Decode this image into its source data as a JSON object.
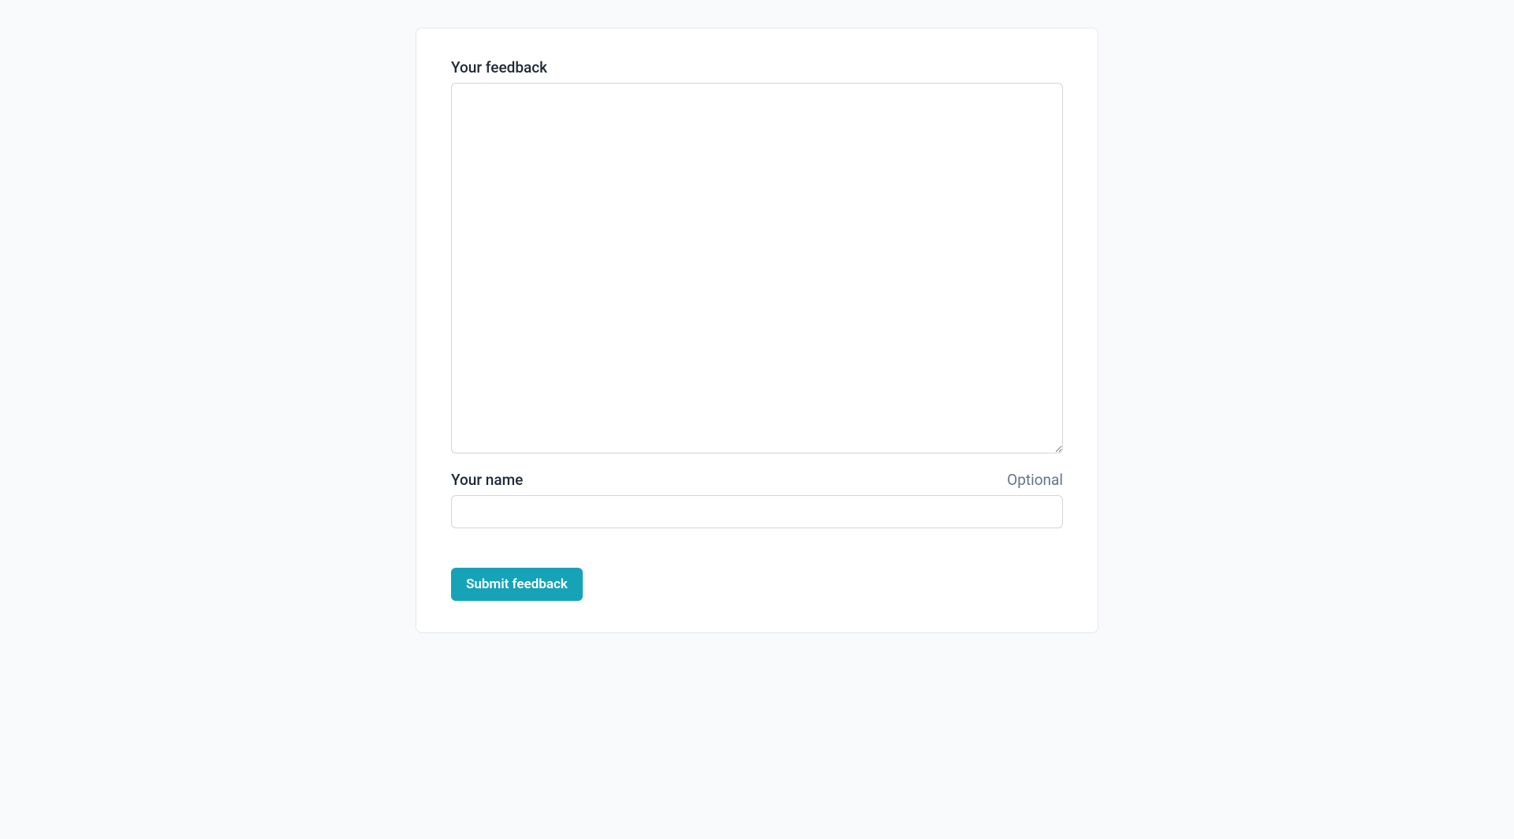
{
  "feedback_field": {
    "label": "Your feedback",
    "value": ""
  },
  "name_field": {
    "label": "Your name",
    "hint": "Optional",
    "value": ""
  },
  "submit_button": {
    "label": "Submit feedback"
  }
}
